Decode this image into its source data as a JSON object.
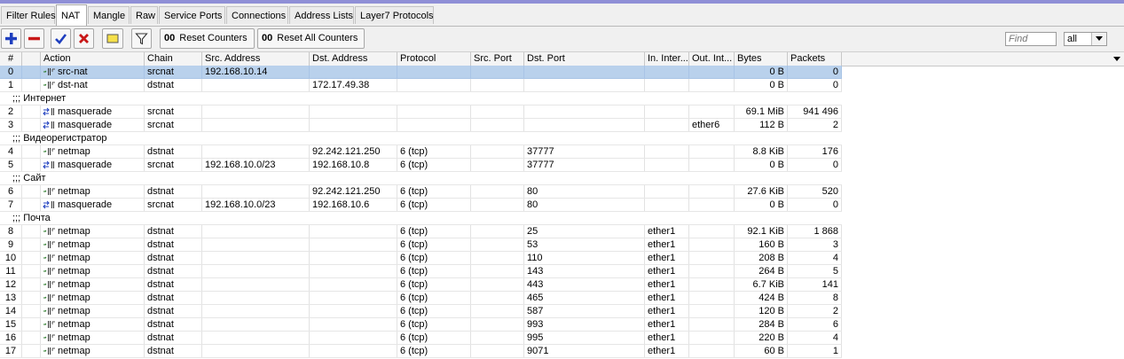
{
  "tabs": [
    {
      "label": "Filter Rules",
      "active": false
    },
    {
      "label": "NAT",
      "active": true
    },
    {
      "label": "Mangle",
      "active": false
    },
    {
      "label": "Raw",
      "active": false
    },
    {
      "label": "Service Ports",
      "active": false
    },
    {
      "label": "Connections",
      "active": false
    },
    {
      "label": "Address Lists",
      "active": false
    },
    {
      "label": "Layer7 Protocols",
      "active": false
    }
  ],
  "toolbar": {
    "icons": [
      "add-icon",
      "remove-icon",
      "enable-icon",
      "disable-icon",
      "comment-icon",
      "filter-icon"
    ],
    "reset_counters_label": "Reset Counters",
    "reset_all_counters_label": "Reset All Counters",
    "counter_glyph": "00",
    "find_placeholder": "Find",
    "filter_value": "all"
  },
  "colors": {
    "selected_row": "#b9d1ec",
    "add_icon": "#1f3fbf",
    "remove_icon": "#c81818",
    "enable_icon": "#1f3fbf",
    "disable_icon": "#c81818",
    "comment_icon": "#f5e04a"
  },
  "columns": [
    "#",
    "",
    "Action",
    "Chain",
    "Src. Address",
    "Dst. Address",
    "Protocol",
    "Src. Port",
    "Dst. Port",
    "In. Inter...",
    "Out. Int...",
    "Bytes",
    "Packets"
  ],
  "rows": [
    {
      "kind": "rule",
      "num": "0",
      "icon": "netmap",
      "action": "src-nat",
      "chain": "srcnat",
      "src": "192.168.10.14",
      "dst": "",
      "proto": "",
      "sport": "",
      "dport": "",
      "in": "",
      "out": "",
      "bytes": "0 B",
      "packets": "0",
      "selected": true
    },
    {
      "kind": "rule",
      "num": "1",
      "icon": "netmap",
      "action": "dst-nat",
      "chain": "dstnat",
      "src": "",
      "dst": "172.17.49.38",
      "proto": "",
      "sport": "",
      "dport": "",
      "in": "",
      "out": "",
      "bytes": "0 B",
      "packets": "0"
    },
    {
      "kind": "comment",
      "text": ";;; Интернет"
    },
    {
      "kind": "rule",
      "num": "2",
      "icon": "masquerade",
      "action": "masquerade",
      "chain": "srcnat",
      "src": "",
      "dst": "",
      "proto": "",
      "sport": "",
      "dport": "",
      "in": "",
      "out": "",
      "bytes": "69.1 MiB",
      "packets": "941 496"
    },
    {
      "kind": "rule",
      "num": "3",
      "icon": "masquerade",
      "action": "masquerade",
      "chain": "srcnat",
      "src": "",
      "dst": "",
      "proto": "",
      "sport": "",
      "dport": "",
      "in": "",
      "out": "ether6",
      "bytes": "112 B",
      "packets": "2"
    },
    {
      "kind": "comment",
      "text": ";;; Видеорегистратор"
    },
    {
      "kind": "rule",
      "num": "4",
      "icon": "netmap",
      "action": "netmap",
      "chain": "dstnat",
      "src": "",
      "dst": "92.242.121.250",
      "proto": "6 (tcp)",
      "sport": "",
      "dport": "37777",
      "in": "",
      "out": "",
      "bytes": "8.8 KiB",
      "packets": "176"
    },
    {
      "kind": "rule",
      "num": "5",
      "icon": "masquerade",
      "action": "masquerade",
      "chain": "srcnat",
      "src": "192.168.10.0/23",
      "dst": "192.168.10.8",
      "proto": "6 (tcp)",
      "sport": "",
      "dport": "37777",
      "in": "",
      "out": "",
      "bytes": "0 B",
      "packets": "0"
    },
    {
      "kind": "comment",
      "text": ";;; Сайт"
    },
    {
      "kind": "rule",
      "num": "6",
      "icon": "netmap",
      "action": "netmap",
      "chain": "dstnat",
      "src": "",
      "dst": "92.242.121.250",
      "proto": "6 (tcp)",
      "sport": "",
      "dport": "80",
      "in": "",
      "out": "",
      "bytes": "27.6 KiB",
      "packets": "520"
    },
    {
      "kind": "rule",
      "num": "7",
      "icon": "masquerade",
      "action": "masquerade",
      "chain": "srcnat",
      "src": "192.168.10.0/23",
      "dst": "192.168.10.6",
      "proto": "6 (tcp)",
      "sport": "",
      "dport": "80",
      "in": "",
      "out": "",
      "bytes": "0 B",
      "packets": "0"
    },
    {
      "kind": "comment",
      "text": ";;; Почта"
    },
    {
      "kind": "rule",
      "num": "8",
      "icon": "netmap",
      "action": "netmap",
      "chain": "dstnat",
      "src": "",
      "dst": "",
      "proto": "6 (tcp)",
      "sport": "",
      "dport": "25",
      "in": "ether1",
      "out": "",
      "bytes": "92.1 KiB",
      "packets": "1 868"
    },
    {
      "kind": "rule",
      "num": "9",
      "icon": "netmap",
      "action": "netmap",
      "chain": "dstnat",
      "src": "",
      "dst": "",
      "proto": "6 (tcp)",
      "sport": "",
      "dport": "53",
      "in": "ether1",
      "out": "",
      "bytes": "160 B",
      "packets": "3"
    },
    {
      "kind": "rule",
      "num": "10",
      "icon": "netmap",
      "action": "netmap",
      "chain": "dstnat",
      "src": "",
      "dst": "",
      "proto": "6 (tcp)",
      "sport": "",
      "dport": "110",
      "in": "ether1",
      "out": "",
      "bytes": "208 B",
      "packets": "4"
    },
    {
      "kind": "rule",
      "num": "11",
      "icon": "netmap",
      "action": "netmap",
      "chain": "dstnat",
      "src": "",
      "dst": "",
      "proto": "6 (tcp)",
      "sport": "",
      "dport": "143",
      "in": "ether1",
      "out": "",
      "bytes": "264 B",
      "packets": "5"
    },
    {
      "kind": "rule",
      "num": "12",
      "icon": "netmap",
      "action": "netmap",
      "chain": "dstnat",
      "src": "",
      "dst": "",
      "proto": "6 (tcp)",
      "sport": "",
      "dport": "443",
      "in": "ether1",
      "out": "",
      "bytes": "6.7 KiB",
      "packets": "141"
    },
    {
      "kind": "rule",
      "num": "13",
      "icon": "netmap",
      "action": "netmap",
      "chain": "dstnat",
      "src": "",
      "dst": "",
      "proto": "6 (tcp)",
      "sport": "",
      "dport": "465",
      "in": "ether1",
      "out": "",
      "bytes": "424 B",
      "packets": "8"
    },
    {
      "kind": "rule",
      "num": "14",
      "icon": "netmap",
      "action": "netmap",
      "chain": "dstnat",
      "src": "",
      "dst": "",
      "proto": "6 (tcp)",
      "sport": "",
      "dport": "587",
      "in": "ether1",
      "out": "",
      "bytes": "120 B",
      "packets": "2"
    },
    {
      "kind": "rule",
      "num": "15",
      "icon": "netmap",
      "action": "netmap",
      "chain": "dstnat",
      "src": "",
      "dst": "",
      "proto": "6 (tcp)",
      "sport": "",
      "dport": "993",
      "in": "ether1",
      "out": "",
      "bytes": "284 B",
      "packets": "6"
    },
    {
      "kind": "rule",
      "num": "16",
      "icon": "netmap",
      "action": "netmap",
      "chain": "dstnat",
      "src": "",
      "dst": "",
      "proto": "6 (tcp)",
      "sport": "",
      "dport": "995",
      "in": "ether1",
      "out": "",
      "bytes": "220 B",
      "packets": "4"
    },
    {
      "kind": "rule",
      "num": "17",
      "icon": "netmap",
      "action": "netmap",
      "chain": "dstnat",
      "src": "",
      "dst": "",
      "proto": "6 (tcp)",
      "sport": "",
      "dport": "9071",
      "in": "ether1",
      "out": "",
      "bytes": "60 B",
      "packets": "1"
    }
  ]
}
